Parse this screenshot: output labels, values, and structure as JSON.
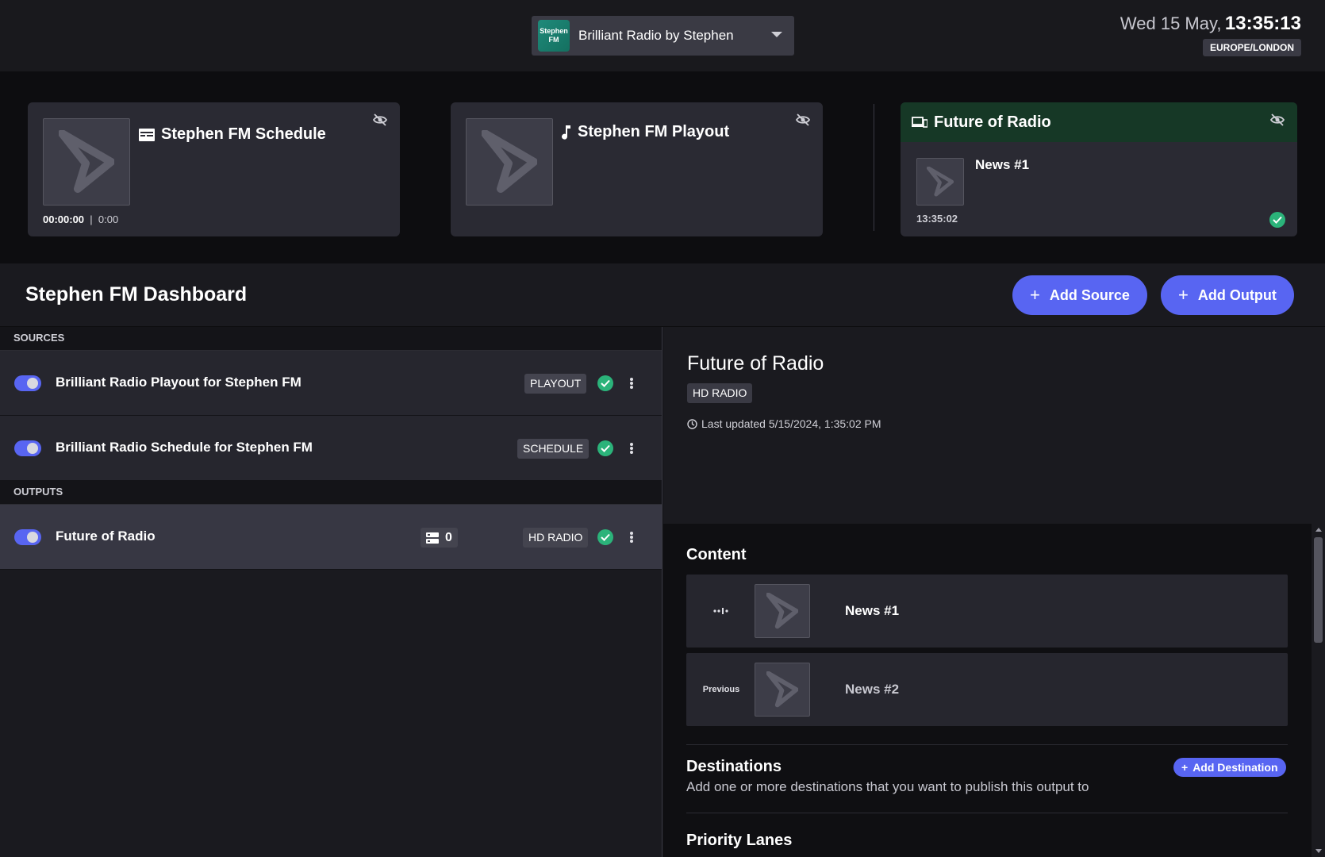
{
  "header": {
    "station_logo_text": "Stephen FM",
    "station_name": "Brilliant Radio by Stephen",
    "clock_date": "Wed 15 May,",
    "clock_time": "13:35:13",
    "timezone": "EUROPE/LONDON"
  },
  "now_playing": {
    "schedule": {
      "title": "Stephen FM Schedule",
      "elapsed": "00:00:00",
      "duration": "0:00",
      "icon": "schedule-icon"
    },
    "playout": {
      "title": "Stephen FM Playout",
      "icon": "music-note-icon"
    },
    "output": {
      "title": "Future of Radio",
      "item": "News #1",
      "time": "13:35:02",
      "icon": "devices-icon",
      "header_color": "#163826"
    }
  },
  "dashboard": {
    "title": "Stephen FM Dashboard",
    "add_source": "Add Source",
    "add_output": "Add Output"
  },
  "sources": {
    "heading": "SOURCES",
    "items": [
      {
        "label": "Brilliant Radio Playout for Stephen FM",
        "tag": "PLAYOUT",
        "enabled": true
      },
      {
        "label": "Brilliant Radio Schedule for Stephen FM",
        "tag": "SCHEDULE",
        "enabled": true
      }
    ]
  },
  "outputs": {
    "heading": "OUTPUTS",
    "items": [
      {
        "label": "Future of Radio",
        "count": "0",
        "tag": "HD RADIO",
        "enabled": true
      }
    ]
  },
  "detail": {
    "title": "Future of Radio",
    "tag": "HD RADIO",
    "last_updated": "Last updated 5/15/2024, 1:35:02 PM",
    "content_heading": "Content",
    "content": [
      {
        "state": "",
        "label": "News #1"
      },
      {
        "state": "Previous",
        "label": "News #2"
      }
    ],
    "destinations_heading": "Destinations",
    "add_destination": "Add Destination",
    "destinations_desc": "Add one or more destinations that you want to publish this output to",
    "priority_heading": "Priority Lanes"
  },
  "colors": {
    "accent": "#5865f2",
    "success": "#2bb37a",
    "background": "#121216"
  }
}
